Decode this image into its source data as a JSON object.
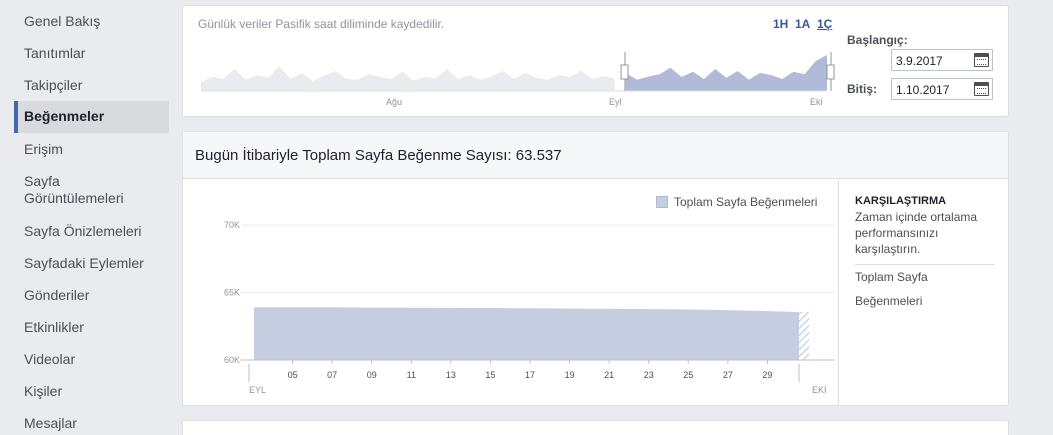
{
  "sidebar": {
    "items": [
      {
        "label": "Genel Bakış"
      },
      {
        "label": "Tanıtımlar"
      },
      {
        "label": "Takipçiler"
      },
      {
        "label": "Beğenmeler"
      },
      {
        "label": "Erişim"
      },
      {
        "label": "Sayfa\nGörüntülemeleri"
      },
      {
        "label": "Sayfa Önizlemeleri"
      },
      {
        "label": "Sayfadaki Eylemler"
      },
      {
        "label": "Gönderiler"
      },
      {
        "label": "Etkinlikler"
      },
      {
        "label": "Videolar"
      },
      {
        "label": "Kişiler"
      },
      {
        "label": "Mesajlar"
      }
    ],
    "active_index": 3
  },
  "range": {
    "note": "Günlük veriler Pasifik saat diliminde kaydedilir.",
    "buttons": [
      "1H",
      "1A",
      "1Ç"
    ],
    "active_button": "1Ç",
    "start_label": "Başlangıç:",
    "start_value": "3.9.2017",
    "end_label": "Bitiş:",
    "end_value": "1.10.2017",
    "mini_axis_labels": [
      "Ağu",
      "Eyl",
      "Eki"
    ]
  },
  "main": {
    "title": "Bugün İtibariyle Toplam Sayfa Beğenme Sayısı: 63.537",
    "legend": "Toplam Sayfa Beğenmeleri"
  },
  "compare": {
    "title": "KARŞILAŞTIRMA",
    "description": "Zaman içinde ortalama performansınızı karşılaştırın.",
    "links": [
      "Toplam Sayfa",
      "Beğenmeleri"
    ]
  },
  "colors": {
    "accent": "#4267b2",
    "link": "#365899",
    "area_fill": "#c5cee0",
    "mini_selected": "#b1bad7",
    "mini_unselected": "#e9ebee"
  },
  "chart_data": {
    "type": "area",
    "title": "",
    "xlabel": "",
    "ylabel": "",
    "ylim": [
      60000,
      70000
    ],
    "y_ticks": [
      "60K",
      "65K",
      "70K"
    ],
    "x_tick_labels": [
      "05",
      "07",
      "09",
      "11",
      "13",
      "15",
      "17",
      "19",
      "21",
      "23",
      "25",
      "27",
      "29"
    ],
    "x_month_labels": [
      "EYL",
      "EKİ"
    ],
    "series": [
      {
        "name": "Toplam Sayfa Beğenmeleri",
        "x": [
          "3.9",
          "4.9",
          "5.9",
          "6.9",
          "7.9",
          "8.9",
          "9.9",
          "10.9",
          "11.9",
          "12.9",
          "13.9",
          "14.9",
          "15.9",
          "16.9",
          "17.9",
          "18.9",
          "19.9",
          "20.9",
          "21.9",
          "22.9",
          "23.9",
          "24.9",
          "25.9",
          "26.9",
          "27.9",
          "28.9",
          "29.9",
          "30.9",
          "1.10"
        ],
        "values": [
          63900,
          63900,
          63900,
          63900,
          63900,
          63890,
          63880,
          63880,
          63870,
          63870,
          63860,
          63850,
          63850,
          63840,
          63830,
          63820,
          63810,
          63800,
          63790,
          63780,
          63770,
          63760,
          63740,
          63720,
          63690,
          63660,
          63620,
          63580,
          63537
        ]
      }
    ],
    "grid": true,
    "legend_position": "top-right"
  },
  "mini_chart_data": {
    "type": "area",
    "values": [
      0.22,
      0.35,
      0.3,
      0.55,
      0.28,
      0.4,
      0.33,
      0.62,
      0.3,
      0.45,
      0.25,
      0.38,
      0.5,
      0.3,
      0.28,
      0.42,
      0.35,
      0.3,
      0.48,
      0.26,
      0.35,
      0.32,
      0.55,
      0.3,
      0.4,
      0.28,
      0.36,
      0.5,
      0.3,
      0.45,
      0.33,
      0.28,
      0.4,
      0.35,
      0.52,
      0.3,
      0.38,
      0.3,
      0.45,
      0.28,
      0.36,
      0.42,
      0.58,
      0.35,
      0.48,
      0.3,
      0.55,
      0.33,
      0.5,
      0.28,
      0.45,
      0.4,
      0.3,
      0.48,
      0.42,
      0.75,
      0.9
    ],
    "selected_start_fraction": 0.663
  }
}
